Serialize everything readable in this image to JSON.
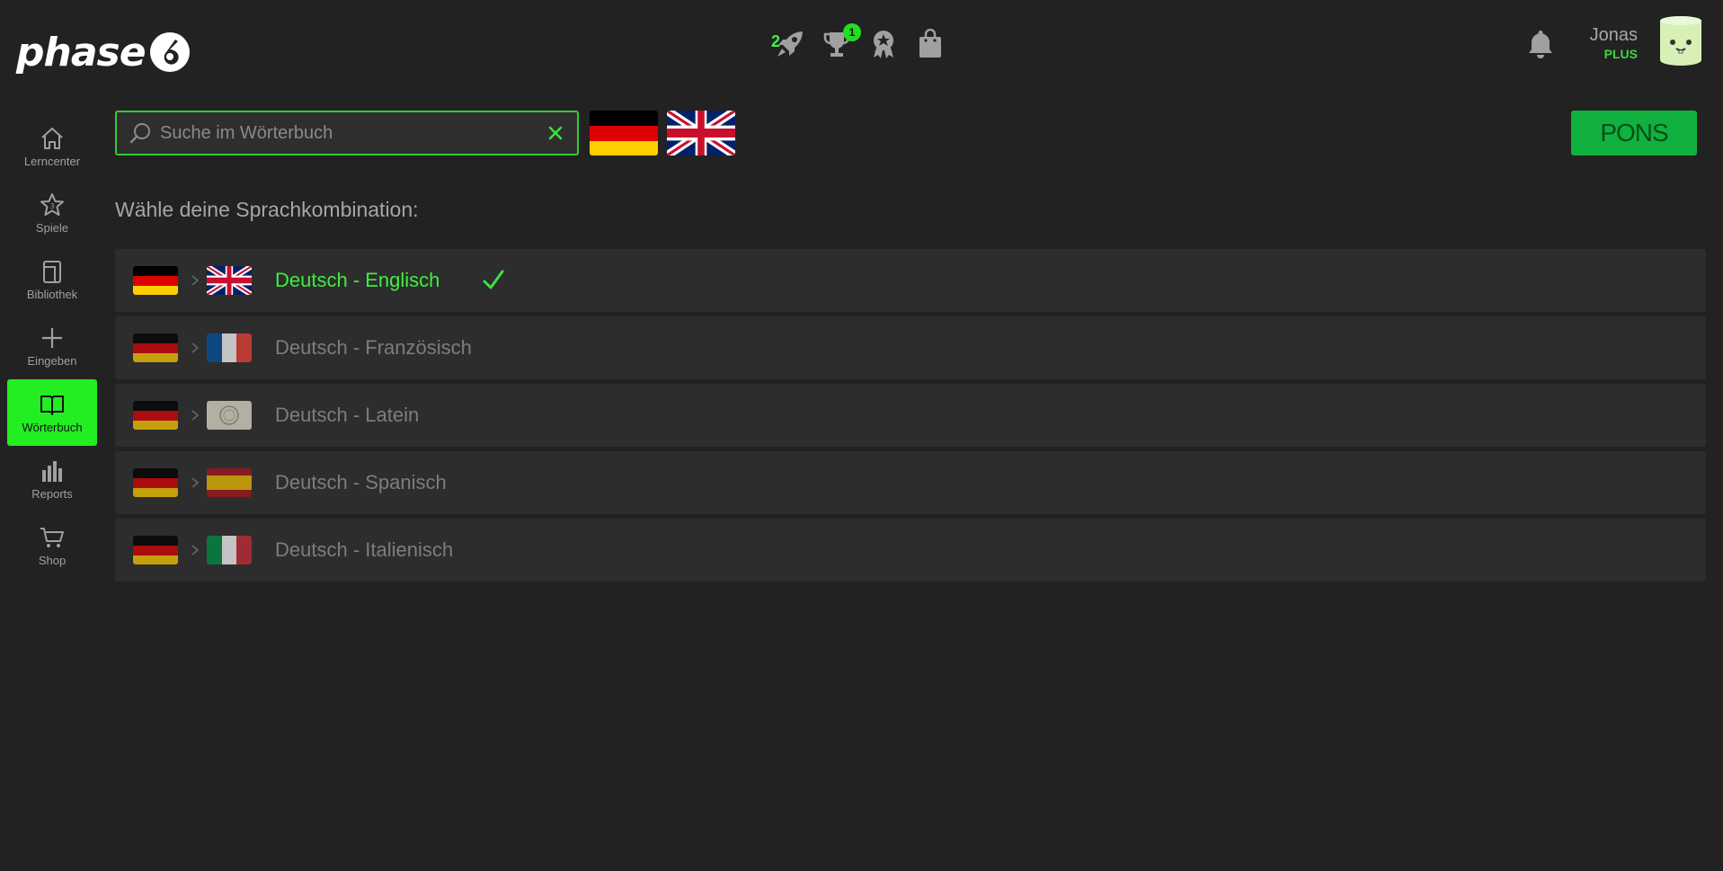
{
  "header": {
    "logo_text": "phase",
    "streak_count": "2",
    "trophy_badge": "1",
    "user_name": "Jonas",
    "user_plan": "PLUS",
    "icons": [
      "rocket-icon",
      "trophy-icon",
      "badge-icon",
      "shopping-bag-icon",
      "bell-icon"
    ]
  },
  "sidebar": {
    "items": [
      {
        "label": "Lerncenter",
        "icon": "home-icon"
      },
      {
        "label": "Spiele",
        "icon": "star-icon"
      },
      {
        "label": "Bibliothek",
        "icon": "book-icon"
      },
      {
        "label": "Eingeben",
        "icon": "plus-icon"
      },
      {
        "label": "Wörterbuch",
        "icon": "open-book-icon",
        "active": true
      },
      {
        "label": "Reports",
        "icon": "bar-chart-icon"
      },
      {
        "label": "Shop",
        "icon": "cart-icon"
      }
    ]
  },
  "search": {
    "placeholder": "Suche im Wörterbuch",
    "value": ""
  },
  "pons_label": "PONS",
  "section_title": "Wähle deine Sprachkombination:",
  "languages": [
    {
      "label": "Deutsch - Englisch",
      "target_flag": "uk",
      "selected": true
    },
    {
      "label": "Deutsch - Französisch",
      "target_flag": "france",
      "selected": false
    },
    {
      "label": "Deutsch - Latein",
      "target_flag": "latin",
      "selected": false
    },
    {
      "label": "Deutsch - Spanisch",
      "target_flag": "spain",
      "selected": false
    },
    {
      "label": "Deutsch - Italienisch",
      "target_flag": "italy",
      "selected": false
    }
  ],
  "colors": {
    "accent": "#22ee22",
    "background": "#222222",
    "row": "#2d2d2d",
    "pons": "#10b13e"
  }
}
